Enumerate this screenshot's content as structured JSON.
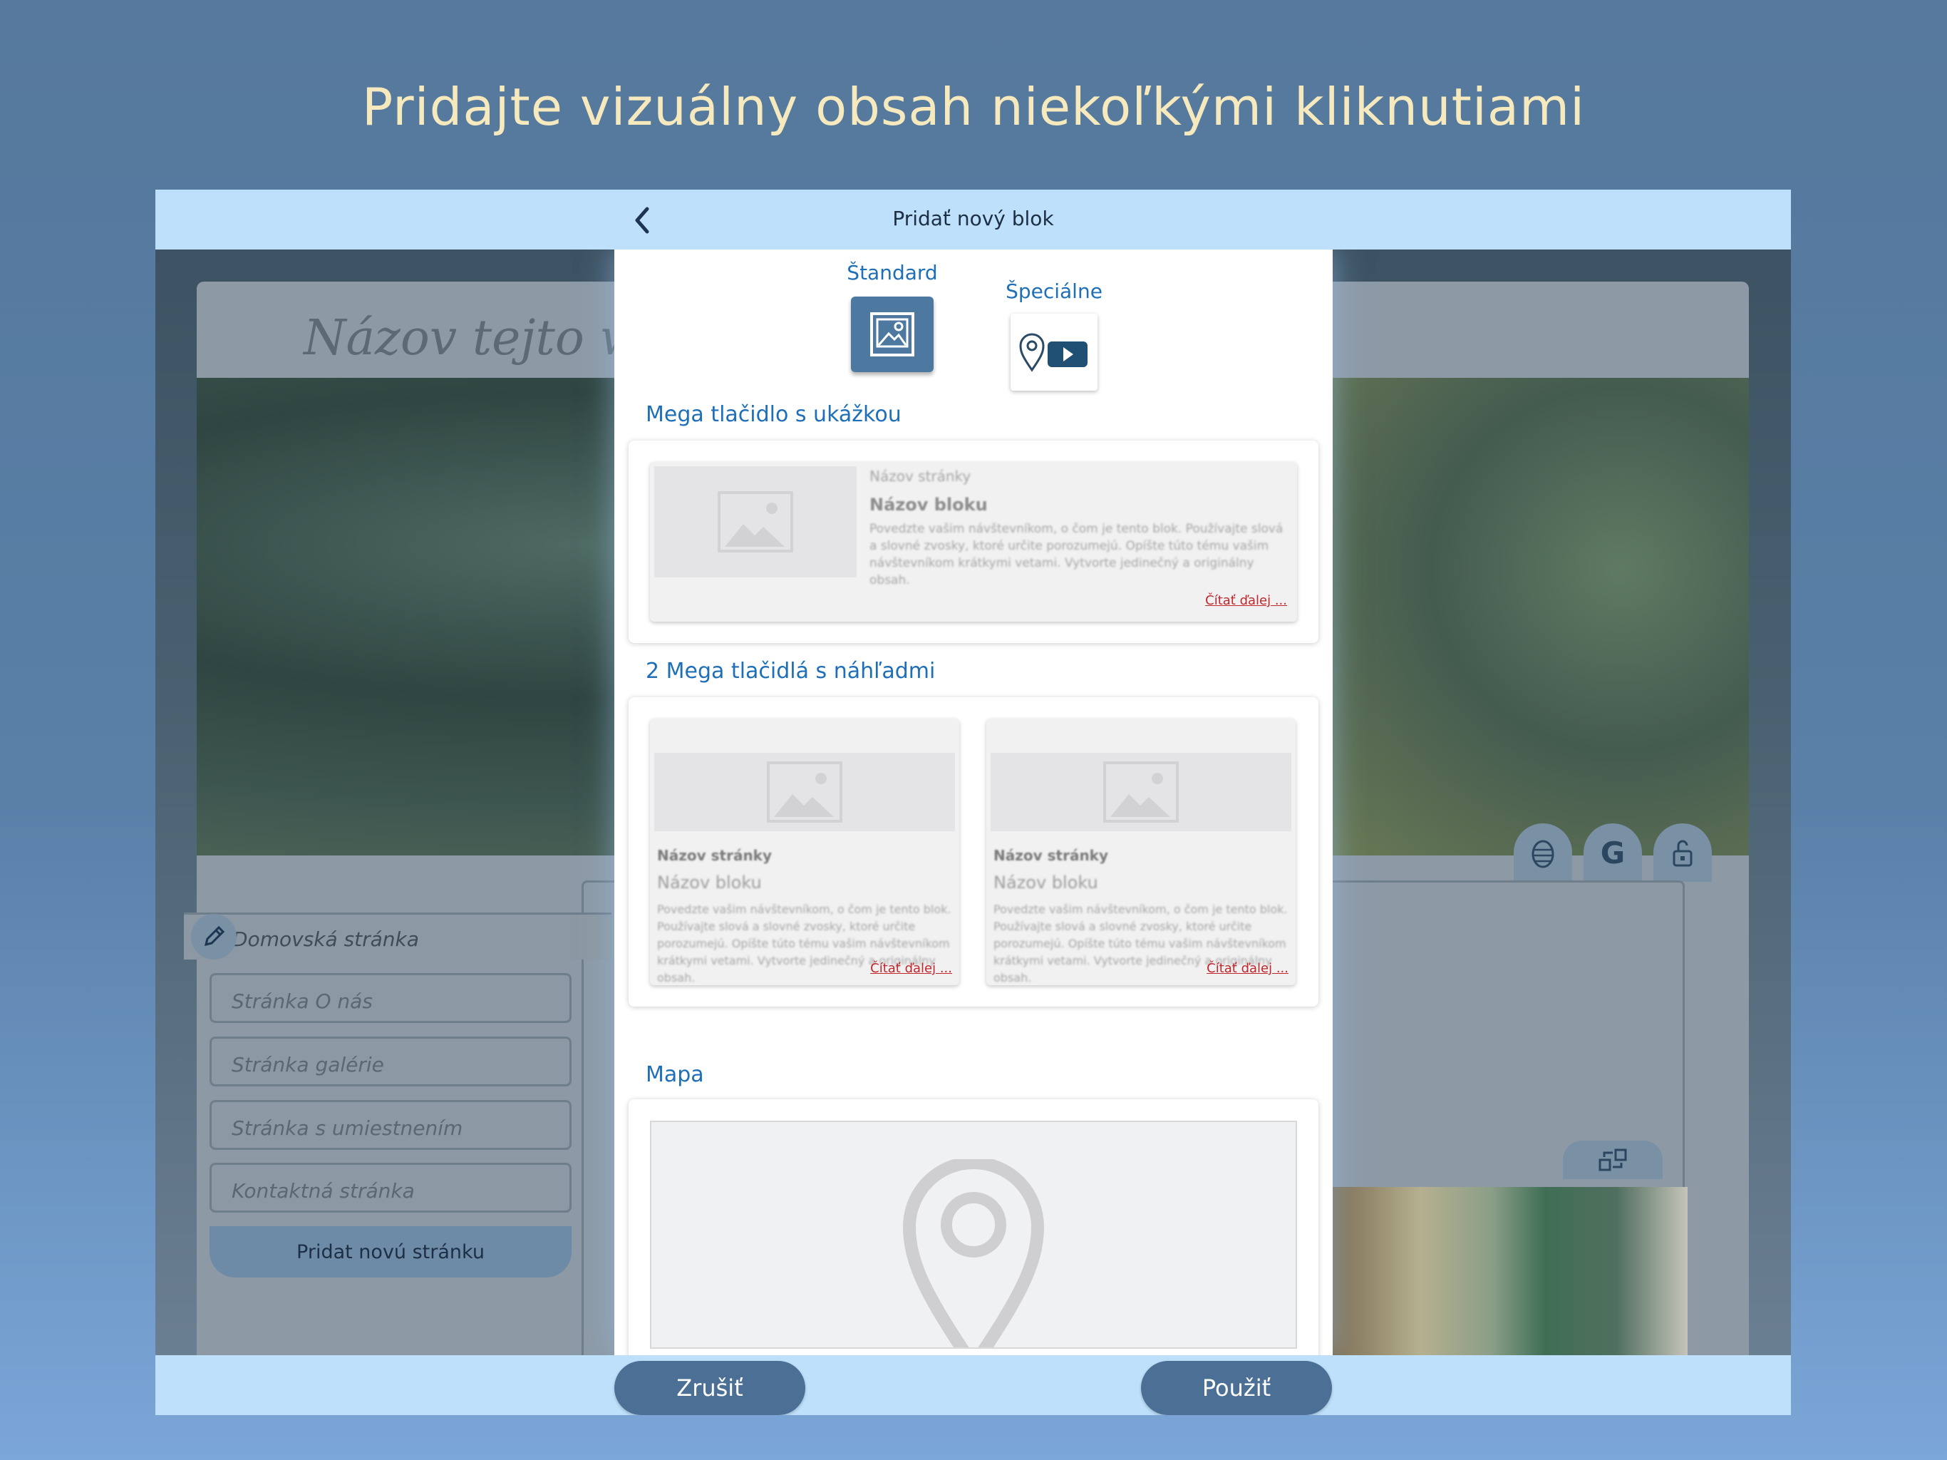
{
  "headline": "Pridajte vizuálny obsah niekoľkými kliknutiami",
  "topbar": {
    "title": "Pridať nový blok"
  },
  "bottombar": {
    "cancel_label": "Zrušiť",
    "apply_label": "Použiť"
  },
  "background_editor": {
    "site_title": "Názov tejto web",
    "home_page": "Domovská stránka",
    "nav_items": [
      "Stránka O nás",
      "Stránka galérie",
      "Stránka s umiestnením",
      "Kontaktná stránka"
    ],
    "add_page_label": "Pridat novú stránku"
  },
  "modal": {
    "tabs": [
      {
        "label": "Štandard",
        "icon": "image-icon",
        "selected": true
      },
      {
        "label": "Špeciálne",
        "icon": "map-video-icon",
        "selected": false
      }
    ],
    "sections": [
      {
        "title": "Mega tlačidlo s ukážkou",
        "cards": [
          {
            "page_name": "Názov stránky",
            "block_name": "Názov bloku",
            "text": "Povedzte vašim návštevníkom, o čom je tento blok. Používajte slová a slovné zvosky, ktoré určite porozumejú. Opíšte túto tému vašim návštevníkom krátkymi vetami. Vytvorte jedinečný a originálny obsah.",
            "read_more": "Čítať ďalej ..."
          }
        ]
      },
      {
        "title": "2 Mega tlačidlá s náhľadmi",
        "cards": [
          {
            "page_name": "Názov stránky",
            "block_name": "Názov bloku",
            "text": "Povedzte vašim návštevníkom, o čom je tento blok. Používajte slová a slovné zvosky, ktoré určite porozumejú. Opíšte túto tému vašim návštevníkom krátkymi vetami. Vytvorte jedinečný a originálny obsah.",
            "read_more": "Čítať ďalej ..."
          },
          {
            "page_name": "Názov stránky",
            "block_name": "Názov bloku",
            "text": "Povedzte vašim návštevníkom, o čom je tento blok. Používajte slová a slovné zvosky, ktoré určite porozumejú. Opíšte túto tému vašim návštevníkom krátkymi vetami. Vytvorte jedinečný a originálny obsah.",
            "read_more": "Čítať ďalej ..."
          }
        ]
      },
      {
        "title": "Mapa",
        "cards": []
      }
    ]
  },
  "colors": {
    "accent": "#1e6fb8",
    "bar": "#bfe0fb",
    "button": "#4c7095",
    "headline": "#f6e9bd",
    "read_more": "#c0272d"
  }
}
